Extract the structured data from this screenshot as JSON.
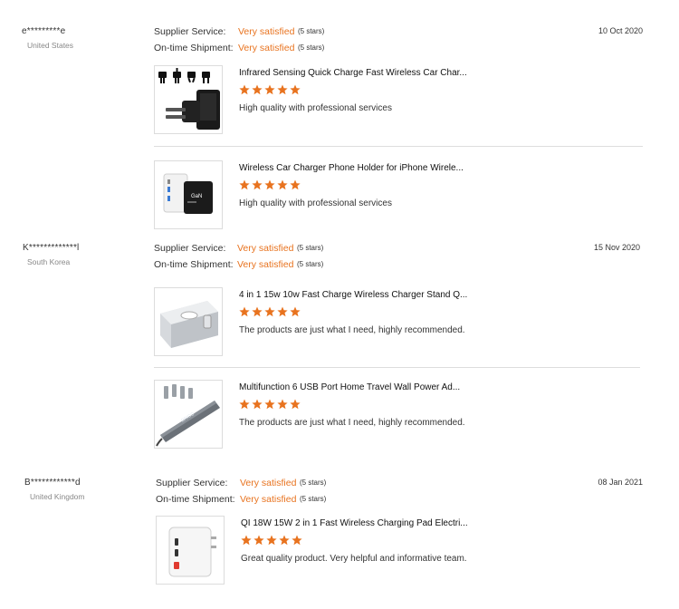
{
  "labels": {
    "supplier_service": "Supplier Service:",
    "on_time_shipment": "On-time Shipment:"
  },
  "colors": {
    "accent": "#e8731f",
    "star": "#e8731f",
    "divider": "#dddddd"
  },
  "reviews": [
    {
      "buyer": "e*********e",
      "country": "United States",
      "date": "10 Oct 2020",
      "supplier_service": {
        "value": "Very satisfied",
        "stars_text": "(5 stars)"
      },
      "on_time_shipment": {
        "value": "Very satisfied",
        "stars_text": "(5 stars)"
      },
      "products": [
        {
          "title": "Infrared Sensing Quick Charge Fast Wireless Car Char...",
          "rating": 5,
          "comment": "High quality with professional services",
          "image": "plug-adapter-image"
        },
        {
          "title": "Wireless Car Charger Phone Holder for iPhone Wirele...",
          "rating": 5,
          "comment": "High quality with professional services",
          "image": "charger-pair-image"
        }
      ]
    },
    {
      "buyer": "K*************l",
      "country": "South Korea",
      "date": "15 Nov 2020",
      "supplier_service": {
        "value": "Very satisfied",
        "stars_text": "(5 stars)"
      },
      "on_time_shipment": {
        "value": "Very satisfied",
        "stars_text": "(5 stars)"
      },
      "products": [
        {
          "title": "4 in 1 15w 10w Fast Charge Wireless Charger Stand Q...",
          "rating": 5,
          "comment": "The products are just what I need, highly recommended.",
          "image": "usb-hub-stand-image"
        },
        {
          "title": "Multifunction 6 USB Port Home Travel Wall Power Ad...",
          "rating": 5,
          "comment": "The products are just what I need, highly recommended.",
          "image": "usb-hub-cable-image"
        }
      ]
    },
    {
      "buyer": "B************d",
      "country": "United Kingdom",
      "date": "08 Jan 2021",
      "supplier_service": {
        "value": "Very satisfied",
        "stars_text": "(5 stars)"
      },
      "on_time_shipment": {
        "value": "Very satisfied",
        "stars_text": "(5 stars)"
      },
      "products": [
        {
          "title": "QI 18W 15W 2 in 1 Fast Wireless Charging Pad Electri...",
          "rating": 5,
          "comment": "Great quality product. Very helpful and informative team.",
          "image": "wall-charger-image"
        }
      ]
    }
  ]
}
